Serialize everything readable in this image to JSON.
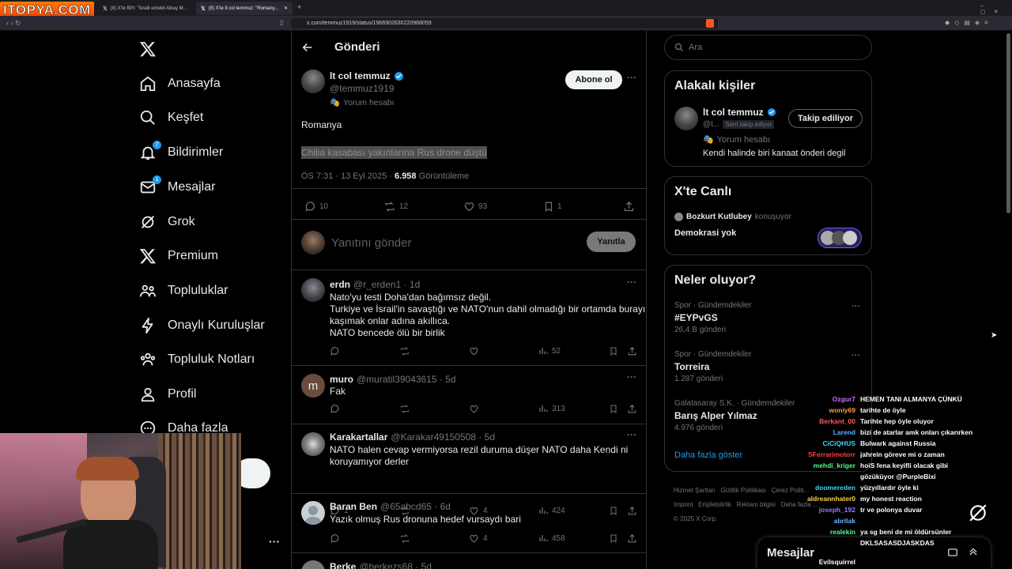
{
  "browser": {
    "watermark": "ITOPYA.COM",
    "tabs": [
      {
        "title": "(8) X'te BPI: \"İsraili emekli Albay M..."
      },
      {
        "title": "(8) X'te lt col temmuz: \"Romany..."
      }
    ],
    "url": "x.com/temmuz1919/status/1966902630220968059"
  },
  "nav": {
    "items": [
      {
        "label": "Anasayfa",
        "icon": "home-icon"
      },
      {
        "label": "Keşfet",
        "icon": "search-icon"
      },
      {
        "label": "Bildirimler",
        "icon": "bell-icon",
        "badge": "7"
      },
      {
        "label": "Mesajlar",
        "icon": "mail-icon",
        "badge": "1"
      },
      {
        "label": "Grok",
        "icon": "grok-icon"
      },
      {
        "label": "Premium",
        "icon": "x-icon"
      },
      {
        "label": "Topluluklar",
        "icon": "people-icon"
      },
      {
        "label": "Onaylı Kuruluşlar",
        "icon": "lightning-icon"
      },
      {
        "label": "Topluluk Notları",
        "icon": "notes-icon"
      },
      {
        "label": "Profil",
        "icon": "person-icon"
      },
      {
        "label": "Daha fazla",
        "icon": "more-circle-icon"
      }
    ]
  },
  "post": {
    "header": "Gönderi",
    "author_name": "lt col temmuz",
    "author_handle": "@temmuz1919",
    "author_tag": "Yorum hesabı",
    "follow_label": "Abone ol",
    "text1": "Romanya",
    "text2": "Chilia kasabası yakınlarına Rus drone düştü",
    "time": "ÖS 7:31 · 13 Eyl 2025 · ",
    "views": "6.958",
    "views_label": " Görüntüleme",
    "replies": "10",
    "reposts": "12",
    "likes": "93",
    "bookmarks": "1",
    "reply_placeholder": "Yanıtını gönder",
    "reply_button": "Yanıtla"
  },
  "replies": [
    {
      "name": "erdn",
      "meta": "@r_erden1 · 1d",
      "lines": [
        "Nato'yu testi Doha'dan bağımsız değil.",
        "Turkiye ve İsrail'in savaştığı ve NATO'nun dahil olmadığı bir ortamda burayı",
        "kaşımak onlar adına akıllıca.",
        "NATO bencede ölü bir birlik"
      ],
      "reply_count": "",
      "repost_count": "",
      "like_count": "",
      "views": "52"
    },
    {
      "name": "muro",
      "meta": "@muratil39043615 · 5d",
      "lines": [
        "Fak"
      ],
      "reply_count": "",
      "repost_count": "",
      "like_count": "",
      "views": "313",
      "avatar_letter": "m"
    },
    {
      "name": "Karakartallar",
      "meta": "@Karakar49150508 · 5d",
      "lines": [
        "NATO halen cevap vermiyorsa rezil duruma düşer NATO daha Kendi ni",
        "koruyamıyor derler"
      ],
      "reply_count": "1",
      "repost_count": "",
      "like_count": "4",
      "views": "424"
    },
    {
      "name": "Baran Ben",
      "meta": "@65abcd65 · 6d",
      "lines": [
        "Yazık olmuş Rus dronuna hedef vursaydı bari"
      ],
      "reply_count": "",
      "repost_count": "",
      "like_count": "4",
      "views": "458"
    },
    {
      "name": "Berke",
      "meta": "@berkezs68 · 5d",
      "lines": [],
      "reply_count": "",
      "repost_count": "",
      "like_count": "",
      "views": ""
    }
  ],
  "right": {
    "search_placeholder": "Ara",
    "related_title": "Alakalı kişiler",
    "related_name": "lt col temmuz",
    "related_handle": "@t...",
    "related_follows_you": "Seni takip ediyor",
    "related_button": "Takip ediliyor",
    "related_tag": "Yorum hesabı",
    "related_bio": "Kendi halinde biri kanaat önderi degil",
    "live_title": "X'te Canlı",
    "live_host": "Bozkurt Kutlubey",
    "live_host_suffix": " konuşuyor",
    "live_topic": "Demokrasi yok",
    "trends_title": "Neler oluyor?",
    "trends": [
      {
        "meta": "Spor · Gündemdekiler",
        "title": "#EYPvGS",
        "count": "26,4 B gönderi"
      },
      {
        "meta": "Spor · Gündemdekiler",
        "title": "Torreira",
        "count": "1.287 gönderi"
      },
      {
        "meta": "Galatasaray S.K. · Gündemdekiler",
        "title": "Barış Alper Yılmaz",
        "count": "4.976 gönderi"
      }
    ],
    "show_more": "Daha fazla göster",
    "footer": [
      "Hizmet Şartları",
      "Gizlilik Politikası",
      "Çerez Politi...",
      "Imprint",
      "Erişilebilirlik",
      "Reklam bilgisi",
      "Daha fazla ...",
      "© 2025 X Corp."
    ],
    "messages_label": "Mesajlar"
  },
  "chat": [
    {
      "user": "Ozgur7",
      "msg": "HEMEN TANI ALMANYA ÇÜNKÜ",
      "color": "#c86bff"
    },
    {
      "user": "woniy69",
      "msg": "tarihte de öyle",
      "color": "#ff9a3c"
    },
    {
      "user": "Berkant_00",
      "msg": "Tarihte hep öyle oluyor",
      "color": "#ff5a5a"
    },
    {
      "user": "Larend",
      "msg": "bizi de atarlar amk onları çıkarırken",
      "color": "#5ab3ff"
    },
    {
      "user": "CiCiQHUS",
      "msg": "Bulwark against Russia",
      "color": "#3ed6ff"
    },
    {
      "user": "SFerrarimotorr",
      "msg": "jahrein göreve mi o zaman",
      "color": "#ff4040"
    },
    {
      "user": "mehdi_kriger",
      "msg": "hoiS fena keyifli olacak gibi",
      "color": "#4dff88"
    },
    {
      "user": "",
      "msg": "gözüküyor @PurpleBixi",
      "color": "#ffffff"
    },
    {
      "user": "doomereden",
      "msg": "yüzyıllardır öyle ki",
      "color": "#3ed6ff"
    },
    {
      "user": "aldreannhater0",
      "msg": "my honest reaction",
      "color": "#ffd24a"
    },
    {
      "user": "joseph_192",
      "msg": "tr ve polonya duvar",
      "color": "#9a7bff"
    },
    {
      "user": "abrilak",
      "msg": "",
      "color": "#6fb0ff"
    },
    {
      "user": "realekin",
      "msg": "ya sg beni de mi öldürsünler",
      "color": "#4dff88"
    },
    {
      "user": "",
      "msg": "DKLSASASDJASKDAS",
      "color": "#ffffff"
    },
    {
      "user": "Evilsquirrel",
      "msg": "",
      "color": "#ffffff"
    }
  ]
}
